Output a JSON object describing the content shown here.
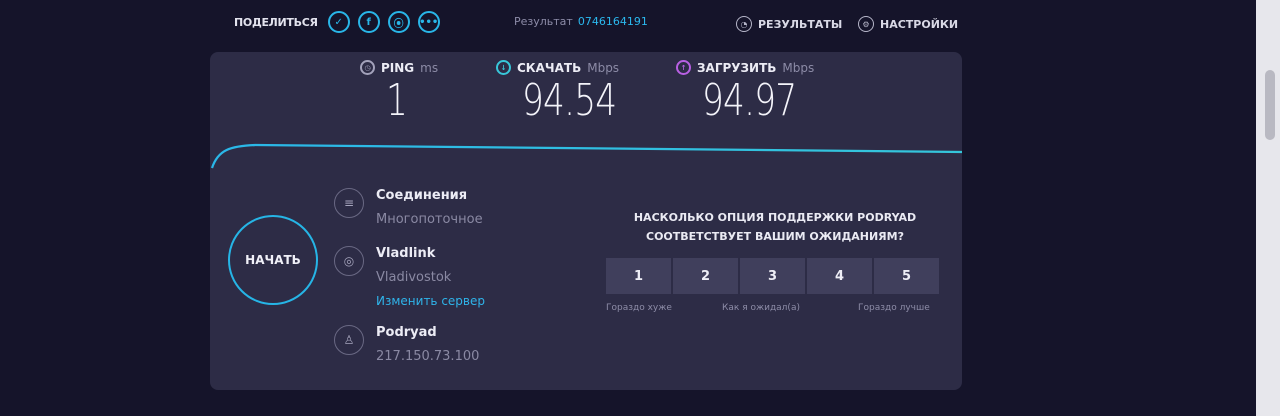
{
  "header": {
    "share_label": "ПОДЕЛИТЬСЯ",
    "social_icons": [
      "twitter-icon",
      "facebook-icon",
      "link-icon",
      "more-icon"
    ],
    "result_label": "Результат",
    "result_id": "0746164191",
    "results_label": "РЕЗУЛЬТАТЫ",
    "settings_label": "НАСТРОЙКИ"
  },
  "metrics": {
    "ping": {
      "label": "PING",
      "unit": "ms",
      "value": "1",
      "color": "#a3a2bb"
    },
    "download": {
      "label": "СКАЧАТЬ",
      "unit": "Mbps",
      "value": "94.54",
      "color": "#38c7d9"
    },
    "upload": {
      "label": "ЗАГРУЗИТЬ",
      "unit": "Mbps",
      "value": "94.97",
      "color": "#b860e3"
    }
  },
  "start_button": "НАЧАТЬ",
  "connection": {
    "title": "Соединения",
    "subtitle": "Многопоточное"
  },
  "server": {
    "name": "Vladlink",
    "city": "Vladivostok",
    "change": "Изменить сервер"
  },
  "provider": {
    "name": "Podryad",
    "ip": "217.150.73.100"
  },
  "survey": {
    "question_line1": "НАСКОЛЬКО ОПЦИЯ ПОДДЕРЖКИ PODRYAD",
    "question_line2": "СООТВЕТСТВУЕТ ВАШИМ ОЖИДАНИЯМ?",
    "options": [
      "1",
      "2",
      "3",
      "4",
      "5"
    ],
    "label_low": "Гораздо хуже",
    "label_mid": "Как я ожидал(а)",
    "label_high": "Гораздо лучше"
  },
  "colors": {
    "accent": "#26b5e6",
    "background": "#15142a",
    "card": "#2d2c46"
  }
}
